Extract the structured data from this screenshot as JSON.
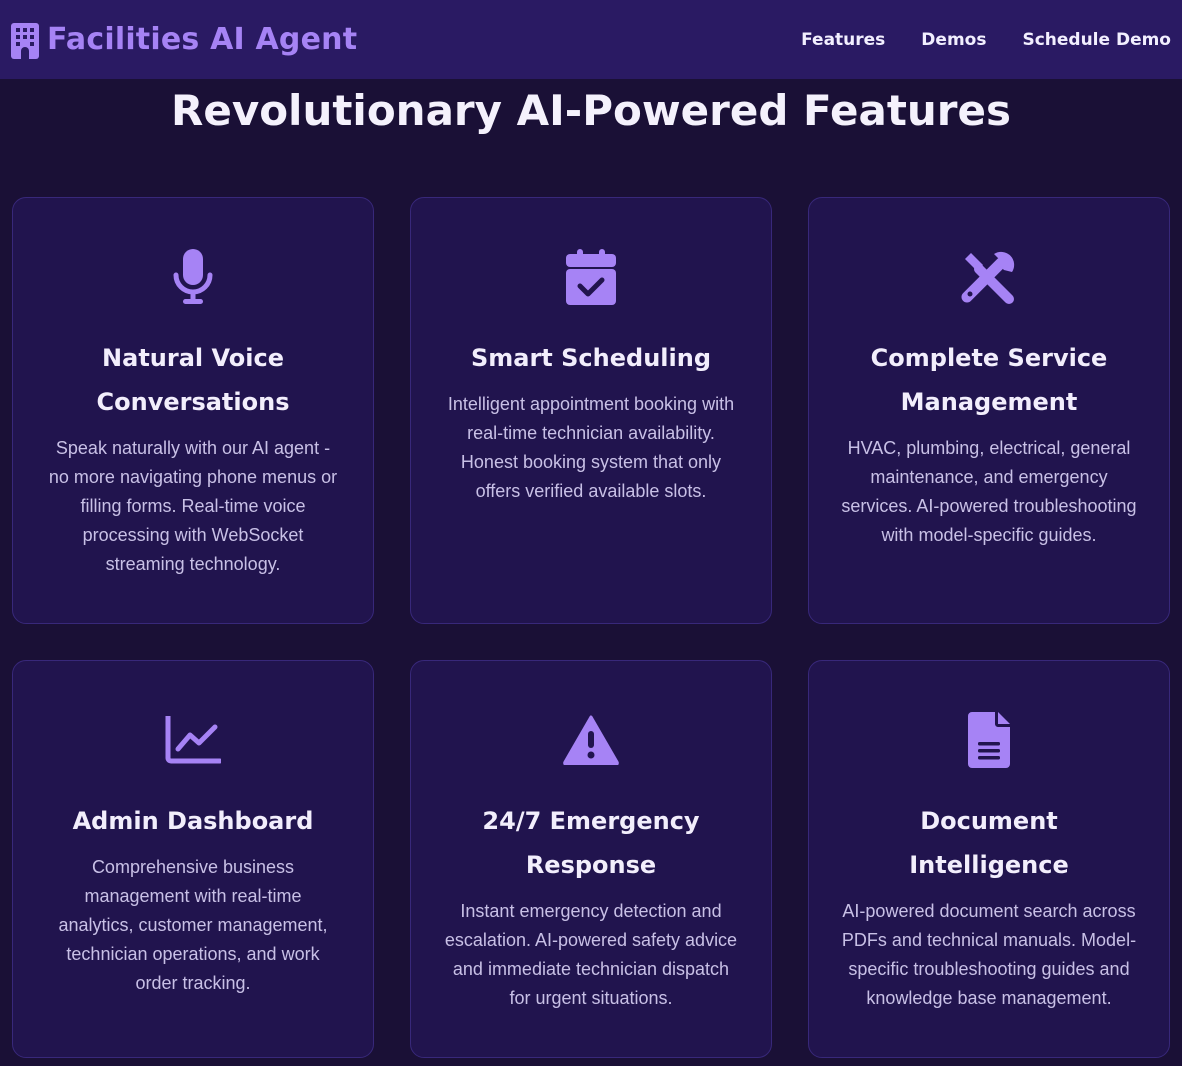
{
  "nav": {
    "brand": "Facilities AI Agent",
    "brand_icon": "building-icon",
    "links": [
      "Features",
      "Demos",
      "Schedule Demo"
    ]
  },
  "section": {
    "title": "Revolutionary AI-Powered Features"
  },
  "colors": {
    "accent": "#a683f5",
    "background": "#1a1036",
    "navbar": "#2a1a63",
    "card": "#21144e"
  },
  "features": [
    {
      "icon": "microphone-icon",
      "title": "Natural Voice Conversations",
      "description": "Speak naturally with our AI agent - no more navigating phone menus or filling forms. Real-time voice processing with WebSocket streaming technology."
    },
    {
      "icon": "calendar-check-icon",
      "title": "Smart Scheduling",
      "description": "Intelligent appointment booking with real-time technician availability. Honest booking system that only offers verified available slots."
    },
    {
      "icon": "tools-icon",
      "title": "Complete Service Management",
      "description": "HVAC, plumbing, electrical, general maintenance, and emergency services. AI-powered troubleshooting with model-specific guides."
    },
    {
      "icon": "chart-line-icon",
      "title": "Admin Dashboard",
      "description": "Comprehensive business management with real-time analytics, customer management, technician operations, and work order tracking."
    },
    {
      "icon": "warning-icon",
      "title": "24/7 Emergency Response",
      "description": "Instant emergency detection and escalation. AI-powered safety advice and immediate technician dispatch for urgent situations."
    },
    {
      "icon": "document-icon",
      "title": "Document Intelligence",
      "description": "AI-powered document search across PDFs and technical manuals. Model-specific troubleshooting guides and knowledge base management."
    }
  ]
}
